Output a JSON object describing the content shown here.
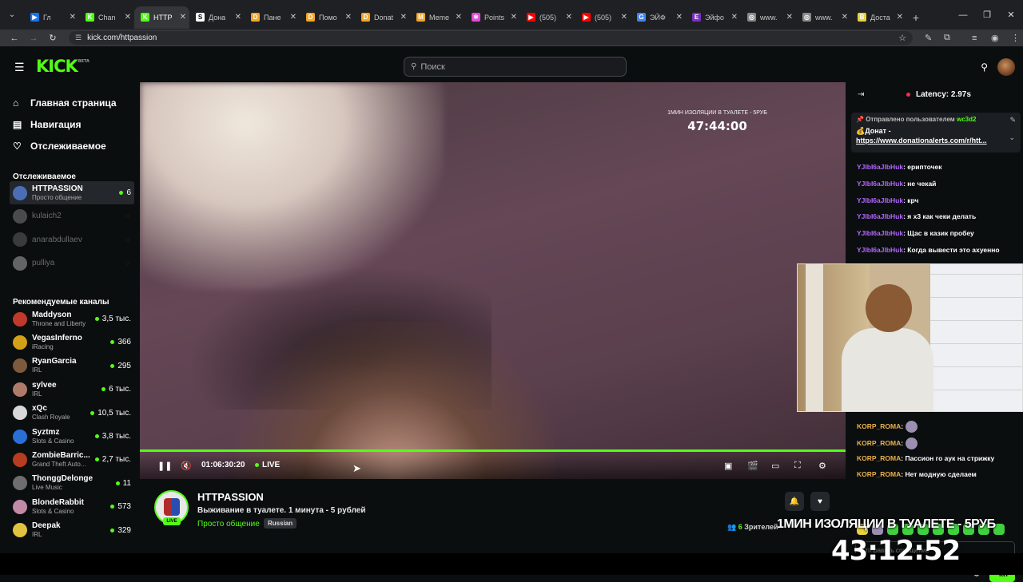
{
  "browser": {
    "tabs": [
      {
        "label": "Гл",
        "color": "#1a73e8",
        "mark": "▶",
        "active": false
      },
      {
        "label": "Chan",
        "color": "#53fc18",
        "mark": "K",
        "active": false
      },
      {
        "label": "HTTP",
        "color": "#53fc18",
        "mark": "K",
        "active": true
      },
      {
        "label": "Дона",
        "color": "#ffffff",
        "mark": "S",
        "active": false
      },
      {
        "label": "Пане",
        "color": "#f5a623",
        "mark": "D",
        "active": false
      },
      {
        "label": "Помо",
        "color": "#f5a623",
        "mark": "D",
        "active": false
      },
      {
        "label": "Donat",
        "color": "#f5a623",
        "mark": "D",
        "active": false
      },
      {
        "label": "Meme",
        "color": "#f5a623",
        "mark": "M",
        "active": false
      },
      {
        "label": "Points",
        "color": "#e04ad8",
        "mark": "✲",
        "active": false
      },
      {
        "label": "(505)",
        "color": "#ff0000",
        "mark": "▶",
        "active": false
      },
      {
        "label": "(505)",
        "color": "#ff0000",
        "mark": "▶",
        "active": false
      },
      {
        "label": "ЭЙФ",
        "color": "#4285f4",
        "mark": "G",
        "active": false
      },
      {
        "label": "Эйфо",
        "color": "#7b2fc2",
        "mark": "E",
        "active": false
      },
      {
        "label": "www.",
        "color": "#888888",
        "mark": "◎",
        "active": false
      },
      {
        "label": "www.",
        "color": "#888888",
        "mark": "◎",
        "active": false
      },
      {
        "label": "Доста",
        "color": "#e8d33a",
        "mark": "B",
        "active": false
      }
    ],
    "url": "kick.com/httpassion"
  },
  "header": {
    "search_placeholder": "Поиск"
  },
  "sidebar": {
    "nav": [
      {
        "label": "Главная страница",
        "icon": "home-icon"
      },
      {
        "label": "Навигация",
        "icon": "browse-icon"
      },
      {
        "label": "Отслеживаемое",
        "icon": "heart-icon"
      }
    ],
    "following_title": "Отслеживаемое",
    "following": [
      {
        "name": "HTTPASSION",
        "category": "Просто общение",
        "viewers": "6",
        "online": true
      },
      {
        "name": "kulaich2",
        "category": "",
        "viewers": "",
        "online": false
      },
      {
        "name": "anarabdullaev",
        "category": "",
        "viewers": "",
        "online": false
      },
      {
        "name": "pulliya",
        "category": "",
        "viewers": "",
        "online": false
      }
    ],
    "recommended_title": "Рекомендуемые каналы",
    "recommended": [
      {
        "name": "Maddyson",
        "category": "Throne and Liberty",
        "viewers": "3,5 тыс."
      },
      {
        "name": "VegasInferno",
        "category": "iRacing",
        "viewers": "366"
      },
      {
        "name": "RyanGarcia",
        "category": "IRL",
        "viewers": "295"
      },
      {
        "name": "sylvee",
        "category": "IRL",
        "viewers": "6 тыс."
      },
      {
        "name": "xQc",
        "category": "Clash Royale",
        "viewers": "10,5 тыс."
      },
      {
        "name": "Syztmz",
        "category": "Slots & Casino",
        "viewers": "3,8 тыс."
      },
      {
        "name": "ZombieBarric...",
        "category": "Grand Theft Auto...",
        "viewers": "2,7 тыс."
      },
      {
        "name": "ThonggDelonge",
        "category": "Live Music",
        "viewers": "11"
      },
      {
        "name": "BlondeRabbit",
        "category": "Slots & Casino",
        "viewers": "573"
      },
      {
        "name": "Deepak",
        "category": "IRL",
        "viewers": "329"
      }
    ]
  },
  "video": {
    "overlay_title": "1МИН ИЗОЛЯЦИИ В ТУАЛЕТЕ - 5РУБ",
    "overlay_timer": "47:44:00",
    "timecode": "01:06:30:20",
    "live_label": "LIVE"
  },
  "stream": {
    "streamer": "HTTPASSION",
    "live_badge": "LIVE",
    "title": "Выживание в туалете. 1 минута - 5 рублей",
    "category": "Просто общение",
    "language": "Russian",
    "viewers_count": "6",
    "viewers_label": "Зрителей"
  },
  "chat": {
    "latency": "Latency: 2.97s",
    "pinned_by_prefix": "Отправлено пользователем",
    "pinned_by_user": "wc3d2",
    "pinned_text": "Донат -",
    "pinned_link": "https://www.donationalerts.com/r/htt...",
    "messages": [
      {
        "user": "YJIbI6aJIbHuk",
        "text": ": ерипточек",
        "color": "purple"
      },
      {
        "user": "YJIbI6aJIbHuk",
        "text": ": не чекай",
        "color": "purple"
      },
      {
        "user": "YJIbI6aJIbHuk",
        "text": ": крч",
        "color": "purple"
      },
      {
        "user": "YJIbI6aJIbHuk",
        "text": ": я х3 как чеки делать",
        "color": "purple"
      },
      {
        "user": "YJIbI6aJIbHuk",
        "text": ": Щас в казик пробеу",
        "color": "purple"
      },
      {
        "user": "YJIbI6aJIbHuk",
        "text": ": Когда вывести это ахуенно",
        "color": "purple"
      }
    ],
    "bottom_messages": [
      {
        "user": "KORP_ROMA",
        "text": ":",
        "emoji": true
      },
      {
        "user": "KORP_ROMA",
        "text": ":",
        "emoji": true
      },
      {
        "user": "KORP_ROMA",
        "text": ": Пассион го аук на стрижку",
        "emoji": false
      },
      {
        "user": "KORP_ROMA",
        "text": ": Нет модную сделаем",
        "emoji": false
      }
    ],
    "input_placeholder": "Отправить сообщение",
    "send_label": "Чат"
  },
  "overlay": {
    "banner": "1МИН ИЗОЛЯЦИИ В ТУАЛЕТЕ - 5РУБ",
    "timer": "43:12:52"
  },
  "colors": {
    "accent": "#53fc18",
    "background": "#0b0e0f",
    "latency_dot": "#ff2b4a"
  }
}
